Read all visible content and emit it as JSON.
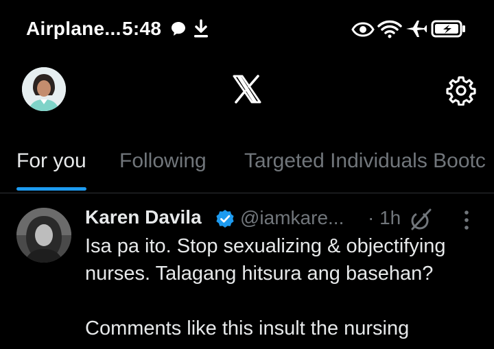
{
  "status_bar": {
    "carrier": "Airplane...",
    "time": "5:48",
    "icons": [
      "chat-bubble-icon",
      "download-icon",
      "eye-icon",
      "wifi-icon",
      "airplane-icon",
      "battery-charging-icon"
    ]
  },
  "header": {
    "logo": "X",
    "icons": [
      "profile-avatar",
      "x-logo",
      "settings-gear-icon"
    ]
  },
  "tabs": [
    {
      "label": "For you",
      "active": true
    },
    {
      "label": "Following",
      "active": false
    },
    {
      "label": "Targeted Individuals Bootc",
      "active": false
    }
  ],
  "colors": {
    "accent": "#1d9bf0",
    "text": "#e7e9ea",
    "muted": "#71767b",
    "background": "#000000",
    "divider": "#2f3336"
  },
  "post": {
    "author": "Karen Davila",
    "handle": "@iamkare...",
    "time": "· 1h",
    "verified": true,
    "lines": [
      "Isa pa ito. Stop sexualizing & objectifying",
      "nurses. Talagang hitsura ang basehan?",
      "",
      "Comments like this insult the nursing"
    ]
  }
}
